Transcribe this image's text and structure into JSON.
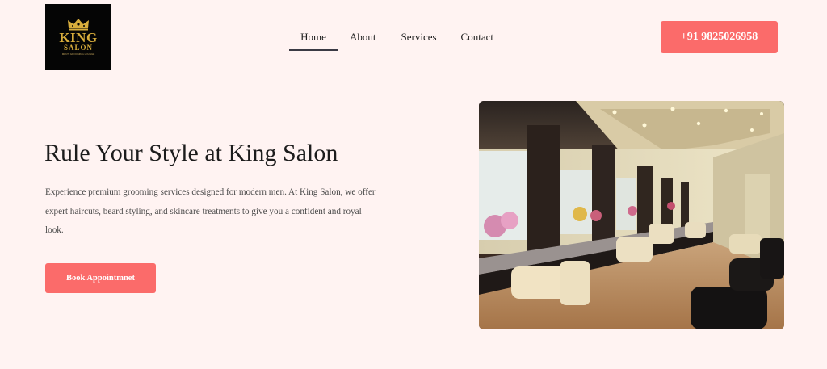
{
  "logo": {
    "title": "KING",
    "subtitle": "SALON",
    "tagline": "MEN'S GROOMING LOUNGE",
    "icon": "crown-icon"
  },
  "nav": {
    "items": [
      {
        "label": "Home",
        "active": true
      },
      {
        "label": "About"
      },
      {
        "label": "Services"
      },
      {
        "label": "Contact"
      }
    ]
  },
  "header": {
    "phone": "+91 9825026958"
  },
  "hero": {
    "title": "Rule Your Style at King Salon",
    "description": "Experience premium grooming services designed for modern men. At King Salon, we offer expert haircuts, beard styling, and skincare treatments to give you a confident and royal look.",
    "cta": "Book Appointmnet"
  },
  "colors": {
    "background": "#fff3f2",
    "accent": "#fb6b6a",
    "text": "#1c1c1c",
    "logo_gold": "#d8ad3c"
  }
}
